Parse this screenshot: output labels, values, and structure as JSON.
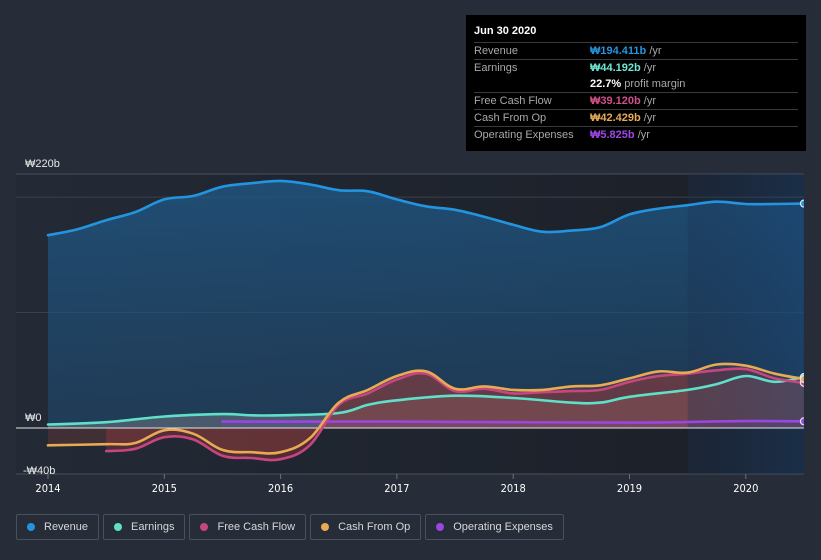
{
  "tooltip": {
    "date": "Jun 30 2020",
    "rows": [
      {
        "label": "Revenue",
        "value": "₩194.411b",
        "suffix": " /yr",
        "color": "#2394df"
      },
      {
        "label": "Earnings",
        "value": "₩44.192b",
        "suffix": " /yr",
        "color": "#6ee7d4"
      },
      {
        "label": "",
        "value": "22.7%",
        "suffix": " profit margin",
        "color": "#ffffff"
      },
      {
        "label": "Free Cash Flow",
        "value": "₩39.120b",
        "suffix": " /yr",
        "color": "#d0508a"
      },
      {
        "label": "Cash From Op",
        "value": "₩42.429b",
        "suffix": " /yr",
        "color": "#e9aa54"
      },
      {
        "label": "Operating Expenses",
        "value": "₩5.825b",
        "suffix": " /yr",
        "color": "#a046e8"
      }
    ]
  },
  "legend": [
    {
      "label": "Revenue",
      "color": "#2394df"
    },
    {
      "label": "Earnings",
      "color": "#5fe0c8"
    },
    {
      "label": "Free Cash Flow",
      "color": "#c8467f"
    },
    {
      "label": "Cash From Op",
      "color": "#e9aa54"
    },
    {
      "label": "Operating Expenses",
      "color": "#9b46e0"
    }
  ],
  "chart_data": {
    "type": "area",
    "title": "",
    "xlabel": "",
    "ylabel": "",
    "currency": "₩",
    "unit": "billions",
    "xlim": [
      2014.0,
      2020.5
    ],
    "ylim": [
      -40,
      220
    ],
    "y_ticks": [
      {
        "value": 220,
        "label": "₩220b"
      },
      {
        "value": 0,
        "label": "₩0"
      },
      {
        "value": -40,
        "label": "-₩40b"
      }
    ],
    "x_ticks": [
      2014,
      2015,
      2016,
      2017,
      2018,
      2019,
      2020
    ],
    "x_tick_labels": [
      "2014",
      "2015",
      "2016",
      "2017",
      "2018",
      "2019",
      "2020"
    ],
    "grid": true,
    "highlight_from": 2019.5,
    "legend_position": "bottom",
    "series": [
      {
        "name": "Revenue",
        "color": "#2394df",
        "x": [
          2014.0,
          2014.25,
          2014.5,
          2014.75,
          2015.0,
          2015.25,
          2015.5,
          2015.75,
          2016.0,
          2016.25,
          2016.5,
          2016.75,
          2017.0,
          2017.25,
          2017.5,
          2017.75,
          2018.0,
          2018.25,
          2018.5,
          2018.75,
          2019.0,
          2019.25,
          2019.5,
          2019.75,
          2020.0,
          2020.25,
          2020.5
        ],
        "values": [
          167,
          172,
          180,
          187,
          198,
          201,
          209,
          212,
          214,
          211,
          206,
          205,
          198,
          192,
          189,
          183,
          176,
          170,
          171,
          174,
          185,
          190,
          193,
          196,
          194,
          194,
          194.4
        ]
      },
      {
        "name": "Earnings",
        "color": "#5fe0c8",
        "x": [
          2014.0,
          2014.5,
          2015.0,
          2015.5,
          2015.75,
          2016.0,
          2016.5,
          2016.75,
          2017.0,
          2017.5,
          2018.0,
          2018.5,
          2018.75,
          2019.0,
          2019.5,
          2019.75,
          2020.0,
          2020.25,
          2020.5
        ],
        "values": [
          3,
          5,
          10,
          12,
          11,
          11,
          13,
          20,
          24,
          28,
          26,
          22,
          22,
          27,
          33,
          38,
          45,
          40,
          44.2
        ]
      },
      {
        "name": "Free Cash Flow",
        "color": "#c8467f",
        "x": [
          2014.5,
          2014.75,
          2015.0,
          2015.25,
          2015.5,
          2015.75,
          2016.0,
          2016.25,
          2016.5,
          2016.75,
          2017.0,
          2017.25,
          2017.5,
          2017.75,
          2018.0,
          2018.25,
          2018.5,
          2018.75,
          2019.0,
          2019.25,
          2019.5,
          2019.75,
          2020.0,
          2020.25,
          2020.5
        ],
        "values": [
          -20,
          -18,
          -8,
          -10,
          -24,
          -26,
          -27,
          -15,
          20,
          30,
          42,
          47,
          32,
          34,
          30,
          31,
          32,
          33,
          40,
          45,
          47,
          50,
          51,
          43,
          39.1
        ]
      },
      {
        "name": "Cash From Op",
        "color": "#e9aa54",
        "x": [
          2014.0,
          2014.5,
          2014.75,
          2015.0,
          2015.25,
          2015.5,
          2015.75,
          2016.0,
          2016.25,
          2016.5,
          2016.75,
          2017.0,
          2017.25,
          2017.5,
          2017.75,
          2018.0,
          2018.25,
          2018.5,
          2018.75,
          2019.0,
          2019.25,
          2019.5,
          2019.75,
          2020.0,
          2020.25,
          2020.5
        ],
        "values": [
          -15,
          -14,
          -13,
          -2,
          -5,
          -19,
          -21,
          -21,
          -9,
          22,
          33,
          45,
          49,
          34,
          36,
          33,
          33,
          36,
          37,
          43,
          49,
          48,
          55,
          54,
          47,
          42.4
        ]
      },
      {
        "name": "Operating Expenses",
        "color": "#9b46e0",
        "x": [
          2015.5,
          2016.0,
          2017.0,
          2018.0,
          2019.0,
          2019.5,
          2020.0,
          2020.5
        ],
        "values": [
          5.5,
          5.5,
          5.5,
          5.0,
          4.7,
          5.2,
          6.0,
          5.8
        ]
      }
    ]
  }
}
